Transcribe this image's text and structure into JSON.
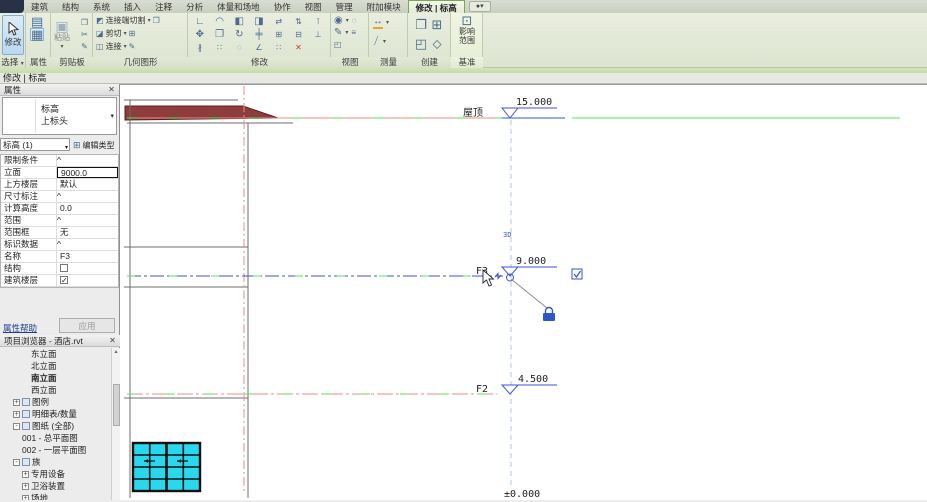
{
  "tabs": [
    {
      "label": "建筑"
    },
    {
      "label": "结构"
    },
    {
      "label": "系统"
    },
    {
      "label": "插入"
    },
    {
      "label": "注释"
    },
    {
      "label": "分析"
    },
    {
      "label": "体量和场地"
    },
    {
      "label": "协作"
    },
    {
      "label": "视图"
    },
    {
      "label": "管理"
    },
    {
      "label": "附加模块"
    },
    {
      "label": "修改 | 标高",
      "active": true
    }
  ],
  "ribbon": {
    "select_panel": "选择",
    "properties_panel": "属性",
    "clipboard_panel": "剪贴板",
    "geometry_panel": "几何图形",
    "modify_panel": "修改",
    "view_panel": "视图",
    "measure_panel": "测量",
    "create_panel": "创建",
    "datum_panel": "基准",
    "modify_button": "修改",
    "paste_button": "粘贴",
    "geometry_rows": {
      "r1": "连接端切割",
      "r2": "剪切",
      "r3": "连接"
    },
    "datum_button_line1": "影响",
    "datum_button_line2": "范围"
  },
  "optionbar": {
    "mode": "修改 | 标高"
  },
  "icons": {
    "dropdown": "▾",
    "combo_arrow": "▾",
    "close": "✕",
    "chevron_up": "^",
    "scroll_up": "▴",
    "check": "✓",
    "properties_a": "▤",
    "properties_b": "▦",
    "paste": "▣",
    "copy": "❐",
    "cut": "✂",
    "match": "✎",
    "cope": "◩",
    "cut_geometry": "◪",
    "join": "◫",
    "align": "∟",
    "offset": "◠",
    "mirror_axis": "◧",
    "mirror_draw": "◨",
    "swap_h": "⇄",
    "swap_v": "⇅",
    "pin": "⊺",
    "move": "✥",
    "rotate": "↻",
    "copy2": "❐",
    "trim": "╪",
    "array": "∷",
    "unpin": "⊥",
    "split": "∦",
    "group": "⊞",
    "ungroup": "⊟",
    "delete": "✕",
    "visibility": "◉",
    "linework": "✎",
    "thinlines": "≡",
    "hide": "◌",
    "dim_aligned": "↔",
    "dim_angular": "∠",
    "create_similar": "❐",
    "plan_views": "⊞",
    "scope_box": "◰",
    "propagate": "⬦",
    "influence": "⊡"
  },
  "properties": {
    "title": "属性",
    "type_family": "标高",
    "type_name": "上标头",
    "instance_combo": "标高 (1)",
    "edit_type": "编辑类型",
    "rows": [
      {
        "type": "section",
        "label": "限制条件"
      },
      {
        "type": "inputsel",
        "label": "立面",
        "value": "9000.0"
      },
      {
        "type": "text",
        "label": "上方楼层",
        "value": "默认"
      },
      {
        "type": "section",
        "label": "尺寸标注"
      },
      {
        "type": "text",
        "label": "计算高度",
        "value": "0.0"
      },
      {
        "type": "section",
        "label": "范围"
      },
      {
        "type": "text",
        "label": "范围框",
        "value": "无"
      },
      {
        "type": "section",
        "label": "标识数据"
      },
      {
        "type": "text",
        "label": "名称",
        "value": "F3"
      },
      {
        "type": "check0",
        "label": "结构"
      },
      {
        "type": "check1",
        "label": "建筑楼层"
      }
    ],
    "help_link": "属性帮助",
    "apply_button": "应用"
  },
  "browser": {
    "title": "项目浏览器 - 酒店.rvt",
    "items": [
      {
        "label": "东立面",
        "indent": 3
      },
      {
        "label": "北立面",
        "indent": 3
      },
      {
        "label": "南立面",
        "indent": 3,
        "bold": true
      },
      {
        "label": "西立面",
        "indent": 3
      },
      {
        "label": "图例",
        "indent": 1,
        "exp": "+",
        "icon": true
      },
      {
        "label": "明细表/数量",
        "indent": 1,
        "exp": "+",
        "icon": true
      },
      {
        "label": "图纸 (全部)",
        "indent": 1,
        "exp": "-",
        "icon": true
      },
      {
        "label": "001 - 总平面图",
        "indent": 2
      },
      {
        "label": "002 - 一层平面图",
        "indent": 2
      },
      {
        "label": "族",
        "indent": 1,
        "exp": "-",
        "icon": true
      },
      {
        "label": "专用设备",
        "indent": 2,
        "exp": "+"
      },
      {
        "label": "卫浴装置",
        "indent": 2,
        "exp": "+"
      },
      {
        "label": "场地",
        "indent": 2,
        "exp": "+"
      }
    ]
  },
  "canvas": {
    "levels": [
      {
        "name": "屋顶",
        "elevation": "15.000"
      },
      {
        "name": "F3",
        "elevation": "9.000"
      },
      {
        "name": "F2",
        "elevation": "4.500"
      }
    ],
    "ground_elevation": "±0.000",
    "mode_3d_label": "3D",
    "colors": {
      "selected_level": "#3b56d6",
      "level_line": "#f08a8a",
      "overlap_level": "#55e455",
      "roof": "#8e3c3c",
      "window_glass": "#29d8ec"
    }
  }
}
